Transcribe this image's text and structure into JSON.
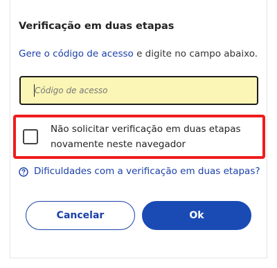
{
  "dialog": {
    "title": "Verificação em duas etapas",
    "instruction": {
      "link_text": "Gere o código de acesso",
      "rest_text": " e digite no campo abaixo."
    },
    "code_input": {
      "placeholder": "Código de acesso",
      "value": ""
    },
    "remember_checkbox": {
      "label": "Não solicitar verificação em duas etapas novamente neste navegador",
      "checked": false
    },
    "help_link": {
      "text": "Dificuldades com a verificação em duas etapas?",
      "icon": "question-circle-icon"
    },
    "buttons": {
      "cancel_label": "Cancelar",
      "ok_label": "Ok"
    }
  },
  "colors": {
    "link": "#1a3fa8",
    "primary": "#1a4bb5",
    "input_background": "#fbf6b5",
    "highlight": "#ee1c1c"
  }
}
